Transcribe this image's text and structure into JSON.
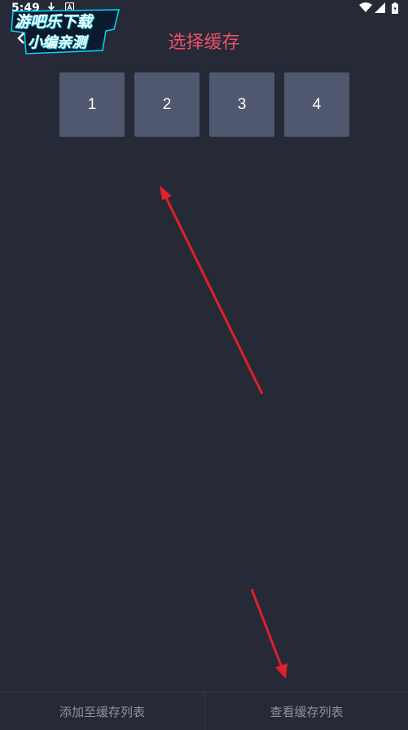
{
  "status_bar": {
    "time": "5:49",
    "icons": [
      "download-icon",
      "notification-icon",
      "wifi-icon",
      "signal-icon",
      "battery-icon"
    ]
  },
  "watermark": {
    "line1": "游吧乐下载",
    "line2": "小编亲测"
  },
  "header": {
    "title": "选择缓存",
    "back_icon": "chevron-left-icon"
  },
  "slots": [
    {
      "label": "1"
    },
    {
      "label": "2"
    },
    {
      "label": "3"
    },
    {
      "label": "4"
    }
  ],
  "bottom_bar": {
    "add_label": "添加至缓存列表",
    "view_label": "查看缓存列表"
  },
  "colors": {
    "background": "#262a36",
    "title": "#ee4f68",
    "slot": "#4f586e",
    "annotation_arrow": "#e0202a"
  }
}
